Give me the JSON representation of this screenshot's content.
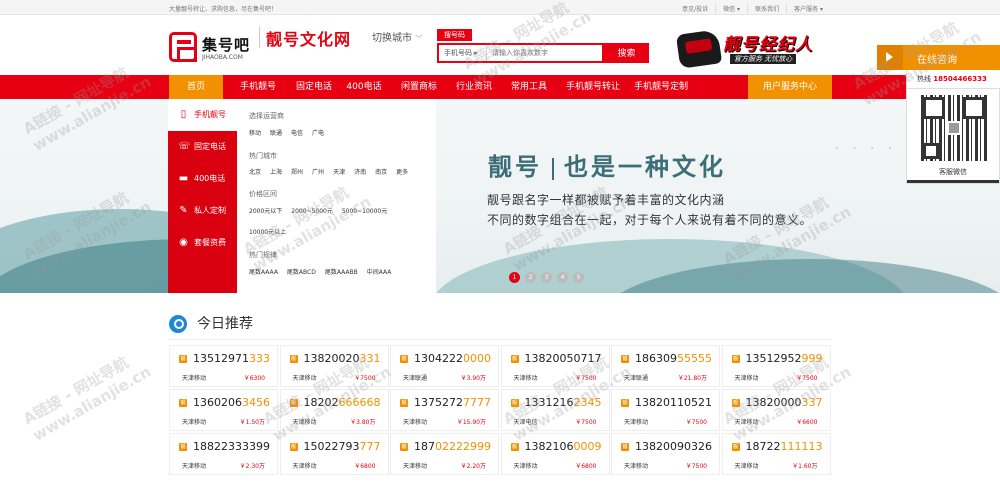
{
  "topbar": {
    "slogan": "大量靓号转让、求购信息，尽在集号吧！",
    "links": [
      "意见/投诉",
      "微信 ▾",
      "联系我们",
      "客户服务 ▾"
    ]
  },
  "header": {
    "logo_text": "集号吧",
    "logo_sub": "JIHAOBA.COM",
    "brand_title": "靓号文化网",
    "city_switch": "切换城市",
    "search_tab": "搜号码",
    "search_select": "手机号码",
    "search_placeholder": "请输入你喜欢数字",
    "search_button": "搜索",
    "agent_title": "靓号经纪人",
    "agent_sub": "官方服务 无忧放心"
  },
  "side_panel": {
    "online_label": "在线咨询",
    "hotline_label": "热线",
    "hotline_number": "18504466333",
    "qr_caption": "客服微信"
  },
  "nav": {
    "items": [
      "首页",
      "手机靓号",
      "固定电话",
      "400电话",
      "闲置商标",
      "行业资讯",
      "常用工具",
      "手机靓号转让",
      "手机靓号定制"
    ],
    "user_center": "用户服务中心"
  },
  "categories": [
    {
      "icon": "phone-icon",
      "label": "手机靓号"
    },
    {
      "icon": "landline-icon",
      "label": "固定电话"
    },
    {
      "icon": "car-icon",
      "label": "400电话"
    },
    {
      "icon": "custom-icon",
      "label": "私人定制"
    },
    {
      "icon": "package-icon",
      "label": "套餐资费"
    }
  ],
  "category_panel": {
    "operator_label": "选择运营商",
    "operators": [
      "移动",
      "联通",
      "电信",
      "广电"
    ],
    "city_label": "热门城市",
    "cities": [
      "北京",
      "上海",
      "郑州",
      "广州",
      "天津",
      "济南",
      "南京",
      "更多"
    ],
    "price_label": "价格区间",
    "prices": [
      "2000元以下",
      "2000~5000元",
      "5000~10000元",
      "10000元以上"
    ],
    "rule_label": "热门规律",
    "rules": [
      "尾数AAAA",
      "尾数ABCD",
      "尾数AAABB",
      "中间AAA"
    ]
  },
  "banner": {
    "title_left": "靓号",
    "title_right": "也是一种文化",
    "line1": "靓号跟名字一样都被赋予着丰富的文化内涵",
    "line2": "不同的数字组合在一起，对于每个人来说有着不同的意义。",
    "pages": [
      "1",
      "2",
      "3",
      "4",
      "5"
    ],
    "active_page": 0
  },
  "recommend": {
    "title": "今日推荐",
    "badge": "靓",
    "items": [
      {
        "prefix": "13512971",
        "highlight": "333",
        "carrier": "天津移动",
        "price": "￥6300"
      },
      {
        "prefix": "13820020",
        "highlight": "331",
        "carrier": "天津移动",
        "price": "￥7500"
      },
      {
        "prefix": "1304222",
        "highlight": "0000",
        "carrier": "天津联通",
        "price": "￥3.90万"
      },
      {
        "prefix": "13820050717",
        "highlight": "",
        "carrier": "天津移动",
        "price": "￥7500"
      },
      {
        "prefix": "186309",
        "highlight": "55555",
        "carrier": "天津联通",
        "price": "￥21.80万"
      },
      {
        "prefix": "13512952",
        "highlight": "999",
        "carrier": "天津移动",
        "price": "￥7500"
      },
      {
        "prefix": "1360206",
        "highlight": "3456",
        "carrier": "天津移动",
        "price": "￥1.50万"
      },
      {
        "prefix": "18202",
        "highlight": "666668",
        "carrier": "天津移动",
        "price": "￥3.80万"
      },
      {
        "prefix": "1375272",
        "highlight": "7777",
        "carrier": "天津移动",
        "price": "￥15.90万"
      },
      {
        "prefix": "1331216",
        "highlight": "2345",
        "carrier": "天津电信",
        "price": "￥7500"
      },
      {
        "prefix": "13820110521",
        "highlight": "",
        "carrier": "天津移动",
        "price": "￥7500"
      },
      {
        "prefix": "13820000",
        "highlight": "337",
        "carrier": "天津移动",
        "price": "￥6600"
      },
      {
        "prefix": "18822333399",
        "highlight": "",
        "carrier": "天津移动",
        "price": "￥2.30万"
      },
      {
        "prefix": "15022793",
        "highlight": "777",
        "carrier": "天津移动",
        "price": "￥6800"
      },
      {
        "prefix": "187",
        "highlight": "02222999",
        "carrier": "天津移动",
        "price": "￥2.20万"
      },
      {
        "prefix": "1382106",
        "highlight": "0009",
        "carrier": "天津移动",
        "price": "￥6800"
      },
      {
        "prefix": "13820090326",
        "highlight": "",
        "carrier": "天津移动",
        "price": "￥7500"
      },
      {
        "prefix": "18722",
        "highlight": "111113",
        "carrier": "天津移动",
        "price": "￥1.60万"
      }
    ]
  },
  "watermark": {
    "line1": "A链接 - 网址导航",
    "line2": "www.alianjie.cn"
  }
}
